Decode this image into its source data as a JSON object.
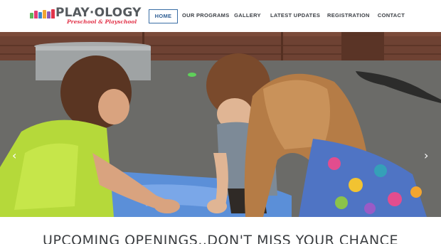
{
  "brand": {
    "name": "PLAY·OLOGY",
    "tagline": "Preschool & Playschool",
    "accent_color": "#e2344a",
    "block_colors": [
      "#5fb65a",
      "#e23c75",
      "#3a86c8",
      "#f2a531",
      "#8e5bb7",
      "#e2344a"
    ]
  },
  "nav": {
    "items": [
      {
        "label": "HOME",
        "active": true
      },
      {
        "label": "OUR PROGRAMS",
        "active": false
      },
      {
        "label": "GALLERY",
        "active": false
      },
      {
        "label": "LATEST UPDATES",
        "active": false
      },
      {
        "label": "REGISTRATION",
        "active": false
      },
      {
        "label": "CONTACT",
        "active": false
      }
    ],
    "active_color": "#3a6ea5"
  },
  "slider": {
    "prev_icon": "chevron-left-icon",
    "next_icon": "chevron-right-icon",
    "prev_glyph": "‹",
    "next_glyph": "›",
    "image_subject": "children-playing-with-chalk-photo"
  },
  "headline": {
    "text": "UPCOMING OPENINGS..DON'T MISS YOUR CHANCE"
  }
}
